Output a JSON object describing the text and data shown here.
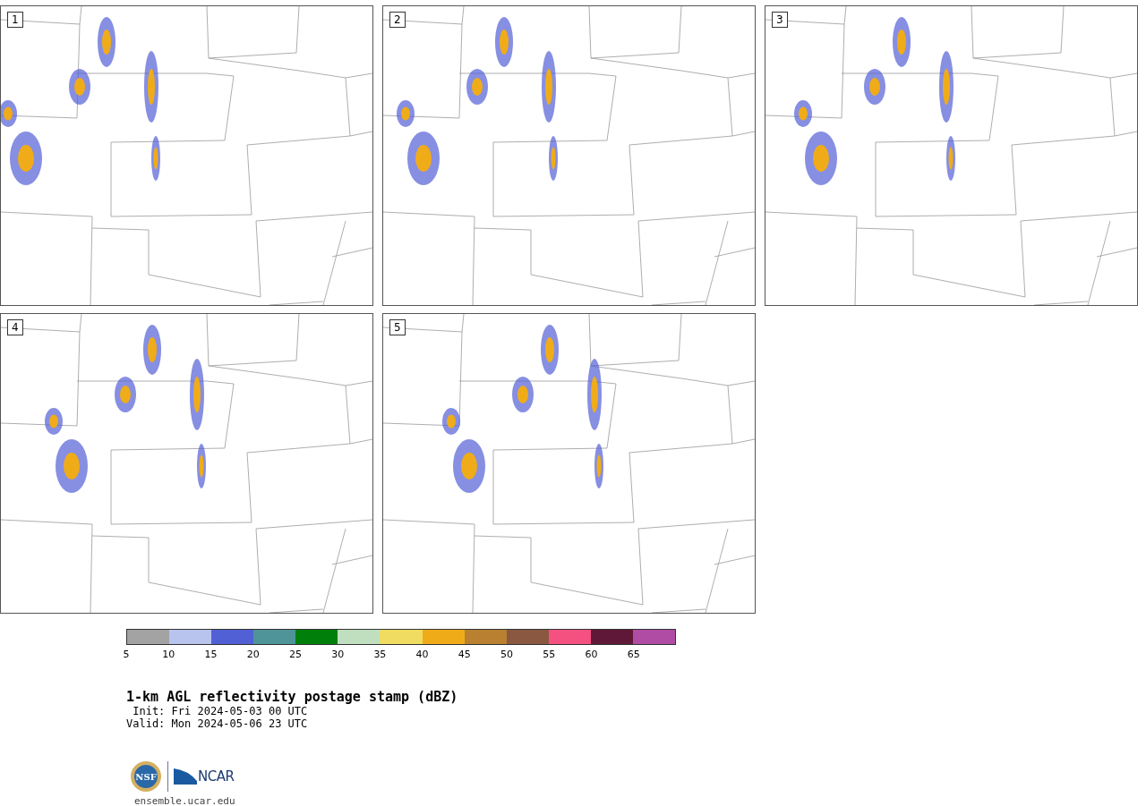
{
  "panels": [
    {
      "label": "1"
    },
    {
      "label": "2"
    },
    {
      "label": "3"
    },
    {
      "label": "4"
    },
    {
      "label": "5"
    }
  ],
  "colorbar": {
    "bins": [
      {
        "color": "#a3a3a3"
      },
      {
        "color": "#b8c4ee"
      },
      {
        "color": "#5260d6"
      },
      {
        "color": "#4e9498"
      },
      {
        "color": "#00800a"
      },
      {
        "color": "#bfdfbf"
      },
      {
        "color": "#f0dc60"
      },
      {
        "color": "#f0ac18"
      },
      {
        "color": "#b88030"
      },
      {
        "color": "#8a5840"
      },
      {
        "color": "#f45080"
      },
      {
        "color": "#601838"
      },
      {
        "color": "#b04ca4"
      }
    ],
    "ticks": [
      "5",
      "10",
      "15",
      "20",
      "25",
      "30",
      "35",
      "40",
      "45",
      "50",
      "55",
      "60",
      "65"
    ]
  },
  "title": "1-km AGL reflectivity postage stamp (dBZ)",
  "init": " Init: Fri 2024-05-03 00 UTC",
  "valid": "Valid: Mon 2024-05-06 23 UTC",
  "logos": {
    "nsf": "NSF",
    "ncar": "NCAR"
  },
  "footer": "ensemble.ucar.edu"
}
